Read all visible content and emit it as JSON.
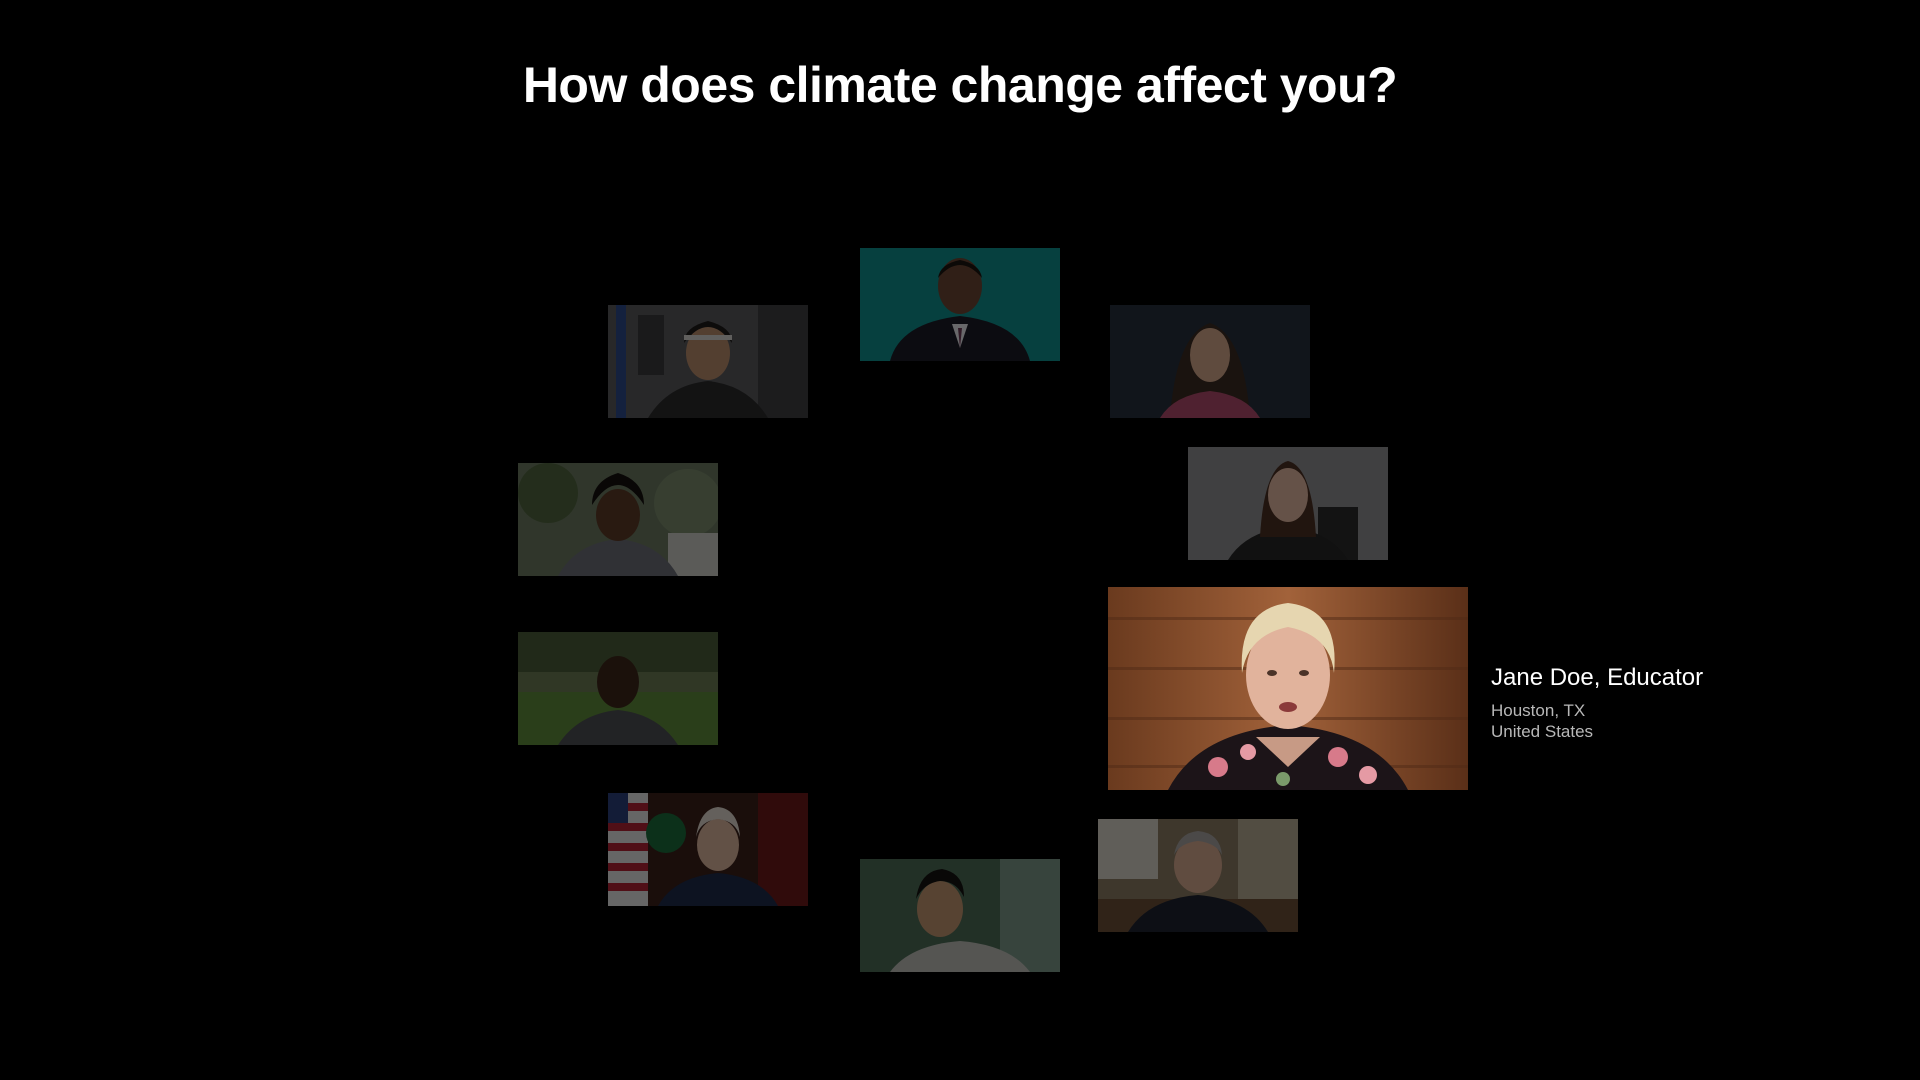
{
  "page": {
    "title": "How does climate change affect you?"
  },
  "featured": {
    "name": "Jane Doe, Educator",
    "city": "Houston, TX",
    "country": "United States"
  },
  "colors": {
    "background": "#000000",
    "title": "#ffffff",
    "caption_secondary": "#b8b8b8"
  },
  "tiles": [
    {
      "id": "top",
      "icon": "person-teal-backdrop"
    },
    {
      "id": "upper-left",
      "icon": "person-gym-backdrop"
    },
    {
      "id": "upper-right",
      "icon": "person-dark-backdrop"
    },
    {
      "id": "middle-left-1",
      "icon": "person-garden-backdrop"
    },
    {
      "id": "middle-right",
      "icon": "person-grey-backdrop"
    },
    {
      "id": "middle-left-2",
      "icon": "person-field-backdrop"
    },
    {
      "id": "featured",
      "icon": "person-wood-backdrop"
    },
    {
      "id": "lower-left",
      "icon": "person-flag-backdrop"
    },
    {
      "id": "bottom",
      "icon": "person-green-backdrop"
    },
    {
      "id": "lower-right",
      "icon": "person-office-backdrop"
    }
  ]
}
